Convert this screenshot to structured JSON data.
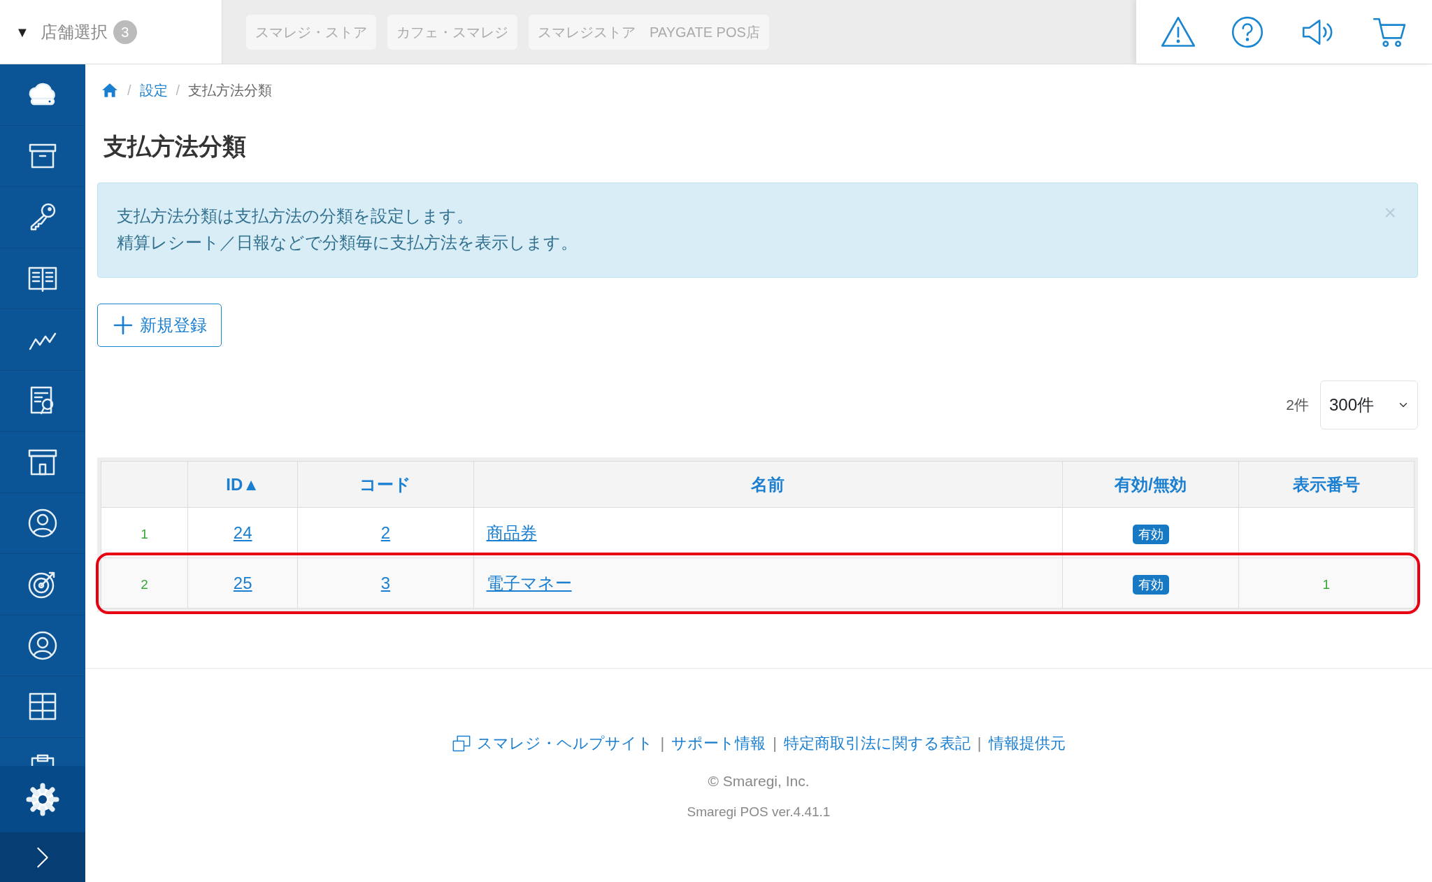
{
  "store_selector": {
    "caret": "▼",
    "label": "店舗選択",
    "count": "3"
  },
  "store_tabs": [
    {
      "label": "スマレジ・ストア"
    },
    {
      "label": "カフェ・スマレジ"
    },
    {
      "label": "スマレジストア　PAYGATE POS店"
    }
  ],
  "sidebar": {
    "items": [
      {
        "selected": false
      },
      {
        "selected": false
      },
      {
        "selected": false
      },
      {
        "selected": false
      },
      {
        "selected": false
      },
      {
        "selected": false
      },
      {
        "selected": false
      },
      {
        "selected": false
      },
      {
        "selected": false
      },
      {
        "selected": false
      },
      {
        "selected": false
      },
      {
        "selected": false
      },
      {
        "selected": true
      }
    ]
  },
  "breadcrumb": [
    {
      "separator": "/",
      "label": "設定"
    },
    {
      "separator": "/",
      "label": "支払方法分類"
    }
  ],
  "title": "支払方法分類",
  "alert": {
    "lines": [
      "支払方法分類は支払方法の分類を設定します。",
      "精算レシート／日報などで分類毎に支払方法を表示します。"
    ],
    "close": "×"
  },
  "new_button": "新規登録",
  "result_count": "2件",
  "page_size": "300件",
  "table": {
    "columns": [
      {},
      {
        "label": "ID▲"
      },
      {
        "label": "コード"
      },
      {
        "label": "名前"
      },
      {
        "label": "有効/無効"
      },
      {
        "label": "表示番号"
      }
    ],
    "rows": [
      {
        "number": "1",
        "id": "24",
        "code": "2",
        "name": "商品券",
        "status": "有効",
        "highlighted": false
      },
      {
        "number": "2",
        "id": "25",
        "code": "3",
        "name": "電子マネー",
        "status": "有効",
        "display_order": "1",
        "highlighted": true
      }
    ]
  },
  "footer": {
    "separators": [
      "|",
      "|",
      "|"
    ],
    "links": [
      "スマレジ・ヘルプサイト",
      "サポート情報",
      "特定商取引法に関する表記",
      "情報提供元"
    ],
    "copyright": "© Smaregi, Inc.",
    "version": "Smaregi POS ver.4.41.1"
  }
}
